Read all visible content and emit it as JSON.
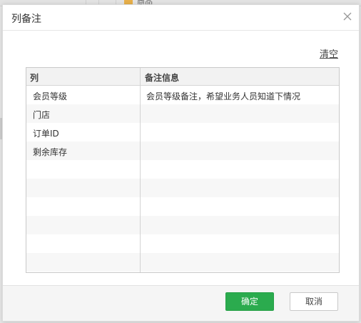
{
  "background": {
    "partial_label": "商品"
  },
  "dialog": {
    "title": "列备注",
    "close_icon": "close-icon",
    "clear_label": "清空",
    "table": {
      "headers": {
        "column": "列",
        "note": "备注信息"
      },
      "rows": [
        {
          "column": "会员等级",
          "note": "会员等级备注，希望业务人员知道下情况"
        },
        {
          "column": "门店",
          "note": ""
        },
        {
          "column": "订单ID",
          "note": ""
        },
        {
          "column": "剩余库存",
          "note": ""
        },
        {
          "column": "",
          "note": ""
        },
        {
          "column": "",
          "note": ""
        },
        {
          "column": "",
          "note": ""
        },
        {
          "column": "",
          "note": ""
        },
        {
          "column": "",
          "note": ""
        },
        {
          "column": "",
          "note": ""
        }
      ]
    },
    "footer": {
      "ok_label": "确定",
      "cancel_label": "取消"
    },
    "colors": {
      "primary_button": "#2bab4e",
      "border": "#c9c9c9"
    }
  }
}
